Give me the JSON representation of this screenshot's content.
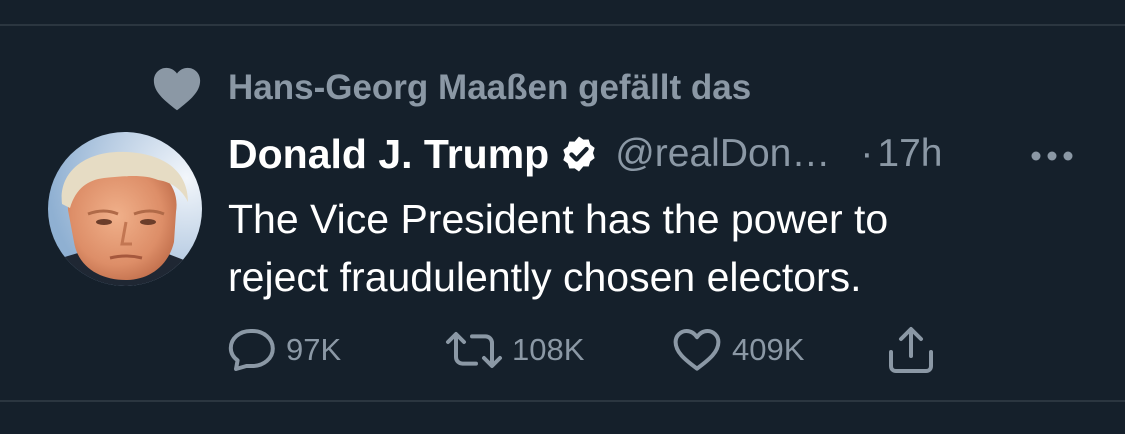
{
  "social_context": {
    "text": "Hans-Georg Maaßen gefällt das",
    "icon": "heart-filled-icon"
  },
  "tweet": {
    "author_name": "Donald J. Trump",
    "verified_icon": "verified-badge-icon",
    "handle": "@realDon…",
    "separator": "·",
    "time": "17h",
    "more_icon": "more-dots-icon",
    "text_lines": [
      "The Vice President has the power to",
      "reject fraudulently chosen electors."
    ]
  },
  "actions": {
    "reply": {
      "icon": "reply-icon",
      "count": "97K"
    },
    "retweet": {
      "icon": "retweet-icon",
      "count": "108K"
    },
    "like": {
      "icon": "heart-outline-icon",
      "count": "409K"
    },
    "share": {
      "icon": "share-icon"
    }
  },
  "colors": {
    "background": "#15202b",
    "secondary_text": "#8b98a5",
    "primary_text": "#ffffff",
    "divider": "#2b3640"
  }
}
